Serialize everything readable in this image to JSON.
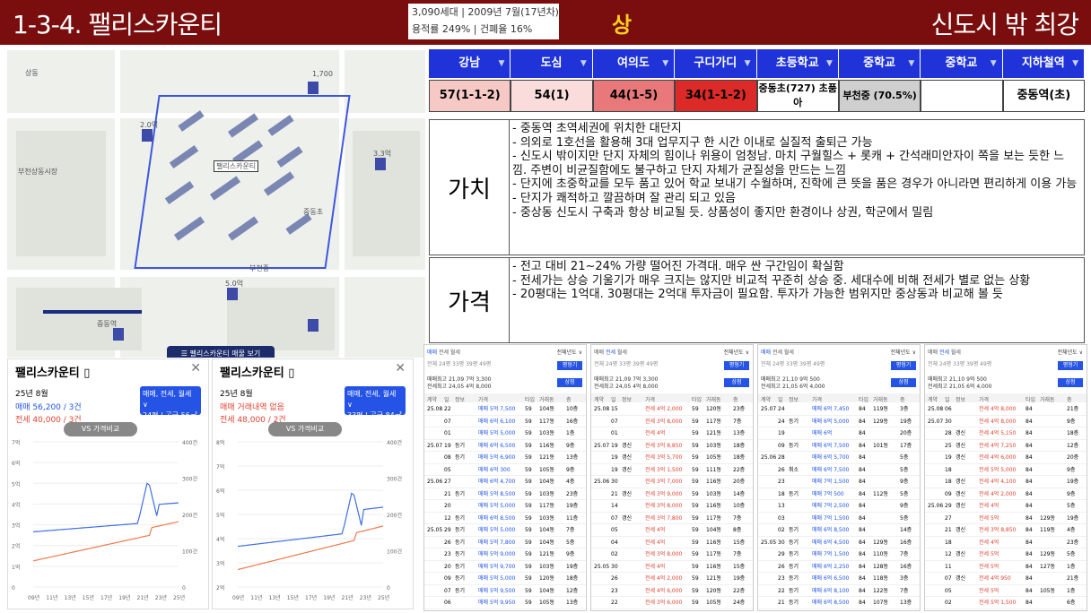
{
  "header": {
    "title": "1-3-4. 팰리스카운티",
    "info_line1": "3,090세대 | 2009년 7월(17년차)",
    "info_line2": "용적률 249% | 건폐율 16%",
    "grade": "상",
    "tagline": "신도시 밖 최강"
  },
  "map": {
    "complex_label": "팰리스카운티",
    "bottom_button": "☰ 팰리스카운티 매물 보기",
    "labels": [
      "부천상동시장",
      "중동초",
      "부천중",
      "중동역",
      "상동",
      "1,700",
      "2.0억",
      "3.3억",
      "5.0억"
    ]
  },
  "access_table": {
    "headers": [
      "강남",
      "도심",
      "여의도",
      "구디가디",
      "초등학교",
      "중학교",
      "중학교",
      "지하철역"
    ],
    "values": [
      "57(1-1-2)",
      "54(1)",
      "44(1-5)",
      "34(1-1-2)",
      "중동초(727) 초품아",
      "부천중 (70.5%)",
      "",
      "중동역(초)"
    ],
    "cell_colors": [
      "#f6c9c6",
      "#f9dcdb",
      "#e8787a",
      "#db2a28",
      "#ffffff",
      "#cfcfcf",
      "#ffffff",
      "#ffffff"
    ]
  },
  "value_box": {
    "label": "가치",
    "items": [
      "중동역 초역세권에 위치한 대단지",
      "의외로 1호선을 활용해 3대 업무지구 한 시간 이내로 실질적 출퇴근 가능",
      "신도시 밖이지만 단지 자체의 힘이나 위용이 엄청남. 마치 구월힐스 + 롯캐 + 간석래미안자이 쪽을 보는 듯한 느낌. 주변이 비균질함에도 불구하고 단지 자체가 균질성을 만드는 느낌",
      "단지에 초중학교를 모두 품고 있어 학교 보내기 수월하며, 진학에 큰 뜻을 품은 경우가 아니라면 편리하게 이용 가능",
      "단지가 쾌적하고 깔끔하며 잘 관리 되고 있음",
      "중상동 신도시 구축과 항상 비교될 듯. 상품성이 좋지만 환경이나 상권, 학군에서 밀림"
    ]
  },
  "price_box": {
    "label": "가격",
    "items": [
      "전고 대비 21~24% 가량 떨어진 가격대. 매우 싼 구간임이 확실함",
      "전세가는 상승 기울기가 매우 크지는 않지만 비교적 꾸준히 상승 중. 세대수에 비해 전세가 별로 없는 상황",
      "20평대는 1억대. 30평대는 2억대 투자금이 필요함. 투자가 가능한 범위지만 중상동과 비교해 볼 듯"
    ]
  },
  "phones": [
    {
      "title": "팰리스카운티",
      "date": "25년 8월",
      "sale": "매매 56,200 / 3건",
      "rent": "전세 40,000 / 3건",
      "btn_line1": "매매, 전세, 월세 ∨",
      "btn_line2": "24평 | 공급 56㎡",
      "vs": "VS 가격비교",
      "y_left": [
        "7억",
        "6억",
        "5억",
        "4억",
        "3억",
        "2억",
        "1억",
        "0"
      ],
      "y_right": [
        "400건",
        "300건",
        "200건",
        "100건",
        "0"
      ],
      "x_ticks": [
        "09년",
        "11년",
        "13년",
        "15년",
        "17년",
        "19년",
        "21년",
        "23년",
        "25년"
      ]
    },
    {
      "title": "팰리스카운티",
      "date": "25년 8월",
      "sale": "매매 거래내역 없음",
      "rent": "전세 48,000 / 2건",
      "btn_line1": "매매, 전세, 월세 ∨",
      "btn_line2": "33평 | 공급 84㎡",
      "vs": "VS 가격비교",
      "y_left": [
        "8억",
        "7억",
        "6억",
        "5억",
        "4억",
        "3억",
        "2억"
      ],
      "y_right": [
        "400건",
        "300건",
        "200건",
        "100건",
        "0"
      ],
      "x_ticks": [
        "09년",
        "11년",
        "13년",
        "15년",
        "17년",
        "19년",
        "21년",
        "23년",
        "25년"
      ]
    }
  ],
  "lists": [
    {
      "summary1": "매매최고 21,09 7억 3,300",
      "summary2": "전세최고 24,05 4억 8,000",
      "rows": [
        [
          "25.08",
          "22",
          "",
          "매매 5억 7,500",
          "59",
          "104동",
          "10층"
        ],
        [
          "",
          "07",
          "",
          "매매 6억 6,100",
          "59",
          "117동",
          "16층"
        ],
        [
          "",
          "01",
          "",
          "매매 5억 5,000",
          "59",
          "103동",
          "1층"
        ],
        [
          "25.07",
          "19",
          "등기",
          "매매 6억 6,500",
          "59",
          "116동",
          "9층"
        ],
        [
          "",
          "08",
          "등기",
          "매매 5억 6,900",
          "59",
          "121동",
          "13층"
        ],
        [
          "",
          "05",
          "",
          "매매 6억 300",
          "59",
          "105동",
          "9층"
        ],
        [
          "25.06",
          "27",
          "",
          "매매 6억 4,700",
          "59",
          "104동",
          "4층"
        ],
        [
          "",
          "21",
          "등기",
          "매매 5억 8,500",
          "59",
          "103동",
          "23층"
        ],
        [
          "",
          "20",
          "",
          "매매 5억 5,000",
          "59",
          "117동",
          "19층"
        ],
        [
          "",
          "12",
          "등기",
          "매매 6억 8,500",
          "59",
          "103동",
          "11층"
        ],
        [
          "25.05",
          "29",
          "등기",
          "매매 5억 5,000",
          "59",
          "104동",
          "7층"
        ],
        [
          "",
          "26",
          "등기",
          "매매 5억 7,800",
          "59",
          "104동",
          "5층"
        ],
        [
          "",
          "23",
          "등기",
          "매매 5억 9,000",
          "59",
          "121동",
          "9층"
        ],
        [
          "",
          "20",
          "등기",
          "매매 5억 9,700",
          "59",
          "103동",
          "19층"
        ],
        [
          "",
          "09",
          "등기",
          "매매 5억 5,000",
          "59",
          "120동",
          "18층"
        ],
        [
          "",
          "07",
          "등기",
          "매매 5억 9,500",
          "59",
          "104동",
          "12층"
        ],
        [
          "",
          "06",
          "",
          "매매 5억 9,950",
          "59",
          "105동",
          "13층"
        ]
      ]
    },
    {
      "summary1": "매매최고 21,09 7억 3,300",
      "summary2": "전세최고 24,05 4억 8,000",
      "rows": [
        [
          "25.08",
          "15",
          "",
          "전세 4억 2,000",
          "59",
          "120동",
          "23층"
        ],
        [
          "",
          "07",
          "",
          "전세 3억 8,000",
          "59",
          "117동",
          "7층"
        ],
        [
          "",
          "01",
          "",
          "전세 4억",
          "59",
          "121동",
          "13층"
        ],
        [
          "25.07",
          "19",
          "갱신",
          "전세 3억 8,850",
          "59",
          "103동",
          "18층"
        ],
        [
          "",
          "19",
          "갱신",
          "전세 3억 5,700",
          "59",
          "105동",
          "18층"
        ],
        [
          "",
          "19",
          "갱신",
          "전세 3억 1,500",
          "59",
          "111동",
          "22층"
        ],
        [
          "25.06",
          "30",
          "",
          "전세 3억 7,000",
          "59",
          "116동",
          "20층"
        ],
        [
          "",
          "21",
          "갱신",
          "전세 3억 9,000",
          "59",
          "103동",
          "14층"
        ],
        [
          "",
          "14",
          "",
          "전세 3억 8,000",
          "59",
          "116동",
          "10층"
        ],
        [
          "",
          "07",
          "갱신",
          "전세 3억 7,800",
          "59",
          "117동",
          "7층"
        ],
        [
          "",
          "05",
          "",
          "전세 4억",
          "59",
          "104동",
          "8층"
        ],
        [
          "",
          "04",
          "",
          "전세 4억",
          "59",
          "116동",
          "15층"
        ],
        [
          "",
          "02",
          "",
          "전세 3억 8,000",
          "59",
          "117동",
          "7층"
        ],
        [
          "25.05",
          "30",
          "",
          "전세 4억",
          "59",
          "116동",
          "15층"
        ],
        [
          "",
          "26",
          "",
          "전세 4억 2,000",
          "59",
          "121동",
          "19층"
        ],
        [
          "",
          "23",
          "",
          "전세 4억 6,000",
          "59",
          "120동",
          "22층"
        ],
        [
          "",
          "22",
          "",
          "전세 3억 6,000",
          "59",
          "105동",
          "24층"
        ]
      ]
    },
    {
      "summary1": "매매최고 21,10 9억 500",
      "summary2": "전세최고 21,05 6억 4,000",
      "rows": [
        [
          "25.07",
          "24",
          "",
          "매매 6억 7,450",
          "84",
          "119동",
          "3층"
        ],
        [
          "",
          "24",
          "등기",
          "매매 6억 5,000",
          "84",
          "129동",
          "19층"
        ],
        [
          "",
          "19",
          "",
          "매매 6억",
          "84",
          "",
          "20층"
        ],
        [
          "",
          "09",
          "등기",
          "매매 6억 7,500",
          "84",
          "101동",
          "17층"
        ],
        [
          "25.06",
          "28",
          "",
          "매매 6억 5,700",
          "84",
          "",
          "5층"
        ],
        [
          "",
          "26",
          "취소",
          "매매 6억 7,500",
          "84",
          "",
          "5층"
        ],
        [
          "",
          "23",
          "",
          "매매 7억 1,500",
          "84",
          "",
          "9층"
        ],
        [
          "",
          "18",
          "등기",
          "매매 7억 500",
          "84",
          "112동",
          "5층"
        ],
        [
          "",
          "13",
          "",
          "매매 7억 2,500",
          "84",
          "",
          "9층"
        ],
        [
          "",
          "03",
          "",
          "매매 7억 1,500",
          "84",
          "",
          "5층"
        ],
        [
          "",
          "02",
          "등기",
          "매매 6억 8,500",
          "84",
          "",
          "14층"
        ],
        [
          "25.05",
          "30",
          "등기",
          "매매 6억 4,500",
          "84",
          "129동",
          "16층"
        ],
        [
          "",
          "29",
          "등기",
          "매매 7억 1,500",
          "84",
          "110동",
          "7층"
        ],
        [
          "",
          "26",
          "등기",
          "매매 6억 2,250",
          "84",
          "128동",
          "16층"
        ],
        [
          "",
          "23",
          "등기",
          "매매 6억 6,500",
          "84",
          "118동",
          "3층"
        ],
        [
          "",
          "22",
          "등기",
          "매매 6억 8,100",
          "84",
          "122동",
          "7층"
        ],
        [
          "",
          "21",
          "등기",
          "매매 6억 8,500",
          "84",
          "107동",
          "13층"
        ]
      ]
    },
    {
      "summary1": "매매최고 21,10 9억 500",
      "summary2": "전세최고 21,05 6억 4,000",
      "rows": [
        [
          "25.08",
          "06",
          "",
          "전세 4억 8,000",
          "84",
          "",
          "21층"
        ],
        [
          "25.07",
          "30",
          "",
          "전세 4억 8,000",
          "84",
          "",
          "9층"
        ],
        [
          "",
          "28",
          "갱신",
          "전세 4억 5,150",
          "84",
          "",
          "18층"
        ],
        [
          "",
          "25",
          "갱신",
          "전세 4억 7,250",
          "84",
          "",
          "12층"
        ],
        [
          "",
          "19",
          "갱신",
          "전세 4억 6,000",
          "84",
          "",
          "20층"
        ],
        [
          "",
          "18",
          "",
          "전세 5억 5,000",
          "84",
          "",
          "9층"
        ],
        [
          "",
          "18",
          "갱신",
          "전세 4억 4,100",
          "84",
          "",
          "19층"
        ],
        [
          "",
          "09",
          "갱신",
          "전세 4억 2,000",
          "84",
          "",
          "9층"
        ],
        [
          "25.06",
          "29",
          "갱신",
          "전세 4억",
          "84",
          "",
          "5층"
        ],
        [
          "",
          "27",
          "",
          "전세 5억",
          "84",
          "129동",
          "19층"
        ],
        [
          "",
          "21",
          "갱신",
          "전세 3억 8,850",
          "84",
          "119동",
          "4층"
        ],
        [
          "",
          "18",
          "",
          "전세 4억",
          "84",
          "",
          "23층"
        ],
        [
          "",
          "12",
          "갱신",
          "전세 5억",
          "84",
          "129동",
          "5층"
        ],
        [
          "",
          "11",
          "",
          "전세 5억",
          "84",
          "127동",
          "1층"
        ],
        [
          "",
          "07",
          "갱신",
          "전세 4억 950",
          "84",
          "",
          "21층"
        ],
        [
          "",
          "05",
          "",
          "전세 5억",
          "84",
          "105동",
          "1층"
        ],
        [
          "",
          "02",
          "",
          "전세 5억 1,500",
          "84",
          "",
          "6층"
        ]
      ]
    }
  ],
  "list_common": {
    "tabs": [
      "매매",
      "전세",
      "월세"
    ],
    "year": "전체년도 ∨",
    "sizes": "전체 24평 33평 39평 49평",
    "size_btn": "평형기",
    "search_btn": "상점",
    "cols": [
      "계약",
      "일",
      "정보",
      "가격",
      "타입",
      "거래동",
      "층"
    ]
  }
}
